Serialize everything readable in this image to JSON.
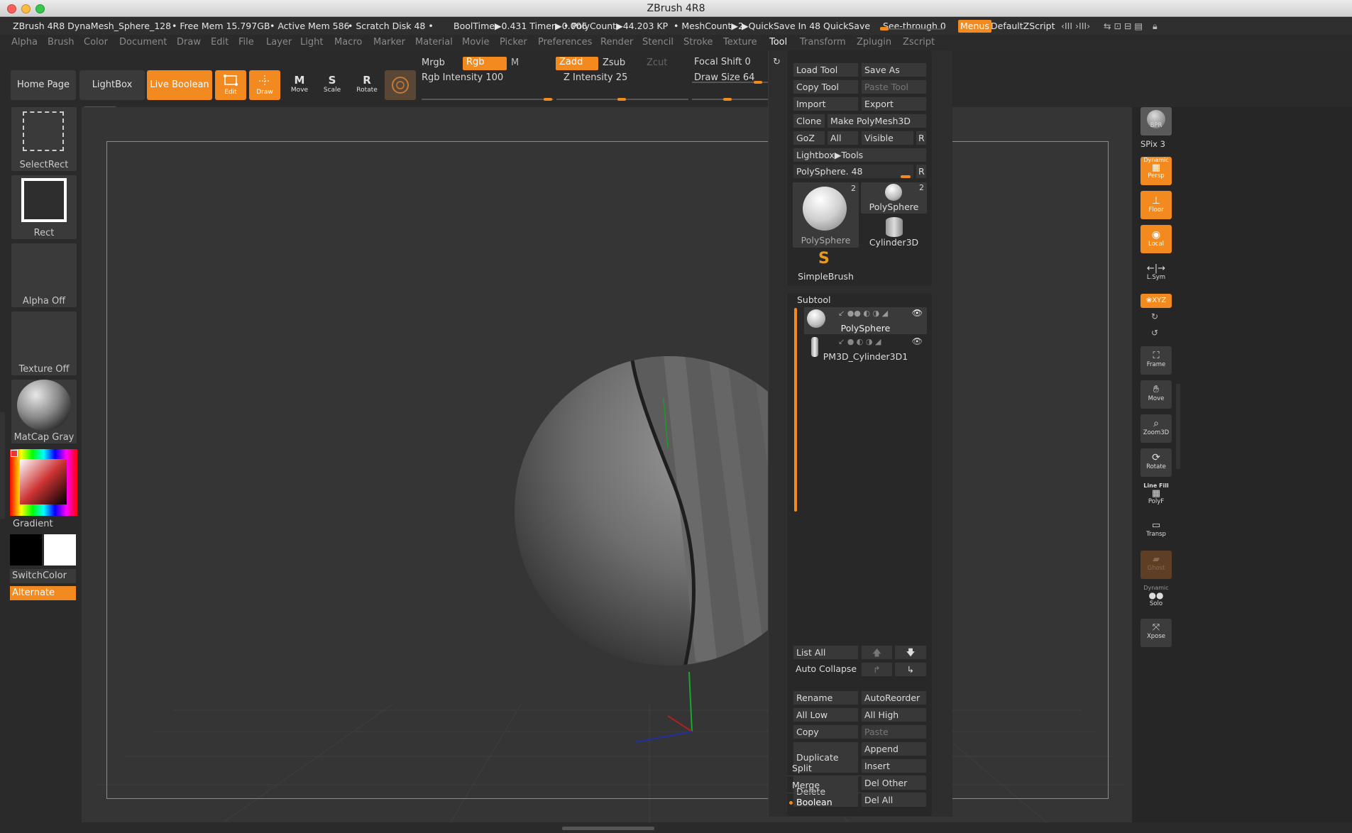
{
  "titlebar": {
    "title": "ZBrush 4R8"
  },
  "infobar": {
    "doc": "ZBrush 4R8 DynaMesh_Sphere_128",
    "free_mem": "• Free Mem 15.797GB",
    "active_mem": "• Active Mem 586",
    "scratch": "• Scratch Disk 48 •",
    "booltime": "BoolTime▶0.431 Timer▶0.006",
    "polycount": "• PolyCount▶44.203 KP",
    "meshcount": "• MeshCount▶2",
    "quicksave_in": "▶QuickSave In 48",
    "quicksave": "QuickSave",
    "seethrough": "See-through  0",
    "menus": "Menus",
    "default_zscript": "DefaultZScript"
  },
  "menubar": [
    "Alpha",
    "Brush",
    "Color",
    "Document",
    "Draw",
    "Edit",
    "File",
    "Layer",
    "Light",
    "Macro",
    "Marker",
    "Material",
    "Movie",
    "Picker",
    "Preferences",
    "Render",
    "Stencil",
    "Stroke",
    "Texture",
    "Tool",
    "Transform",
    "Zplugin",
    "Zscript"
  ],
  "toolbar": {
    "home_page": "Home Page",
    "lightbox": "LightBox",
    "live_boolean": "Live Boolean",
    "edit": "Edit",
    "draw": "Draw",
    "move": "Move",
    "scale": "Scale",
    "rotate": "Rotate",
    "mrgb": "Mrgb",
    "rgb": "Rgb",
    "m": "M",
    "rgb_intensity": "Rgb Intensity 100",
    "zadd": "Zadd",
    "zsub": "Zsub",
    "zcut": "Zcut",
    "z_intensity": "Z Intensity 25",
    "focal_shift": "Focal Shift 0",
    "draw_size": "Draw Size 64"
  },
  "leftpanel": {
    "selectrect": "SelectRect",
    "rect": "Rect",
    "alpha_off": "Alpha Off",
    "texture_off": "Texture Off",
    "material": "MatCap Gray",
    "gradient": "Gradient",
    "switchcolor": "SwitchColor",
    "alternate": "Alternate"
  },
  "rightshelf": {
    "bpr": "BPR",
    "spix": "SPix 3",
    "dynamic": "Dynamic",
    "persp": "Persp",
    "floor": "Floor",
    "local": "Local",
    "lsym": "L.Sym",
    "xyz": "❀XYZ",
    "frame": "Frame",
    "move": "Move",
    "zoom3d": "Zoom3D",
    "rotate": "Rotate",
    "linefill": "Line Fill",
    "polyf": "PolyF",
    "transp": "Transp",
    "ghost": "Ghost",
    "dynamic2": "Dynamic",
    "solo": "Solo",
    "xpose": "Xpose"
  },
  "toolpanel": {
    "load_tool": "Load Tool",
    "save_as": "Save As",
    "copy_tool": "Copy Tool",
    "paste_tool": "Paste Tool",
    "import": "Import",
    "export": "Export",
    "clone": "Clone",
    "make_polymesh": "Make PolyMesh3D",
    "goz": "GoZ",
    "all": "All",
    "visible": "Visible",
    "r": "R",
    "lightbox_tools": "Lightbox▶Tools",
    "polysphere_slider": "PolySphere. 48",
    "tools": [
      {
        "name": "PolySphere",
        "count": "2"
      },
      {
        "name": "PolySphere",
        "count": "2"
      },
      {
        "name": "Cylinder3D",
        "count": ""
      },
      {
        "name": "SimpleBrush",
        "count": ""
      }
    ],
    "subtool_header": "Subtool",
    "subtools": [
      {
        "name": "PolySphere"
      },
      {
        "name": "PM3D_Cylinder3D1"
      }
    ],
    "list_all": "List All",
    "auto_collapse": "Auto Collapse",
    "rename": "Rename",
    "autoreorder": "AutoReorder",
    "all_low": "All Low",
    "all_high": "All High",
    "copy": "Copy",
    "paste": "Paste",
    "duplicate": "Duplicate",
    "append": "Append",
    "insert": "Insert",
    "delete": "Delete",
    "del_other": "Del Other",
    "del_all": "Del All",
    "split": "Split",
    "merge": "Merge",
    "boolean": "Boolean"
  },
  "colors": {
    "accent": "#f28a1f",
    "panel": "#2e2e2e",
    "canvas": "#353535"
  }
}
